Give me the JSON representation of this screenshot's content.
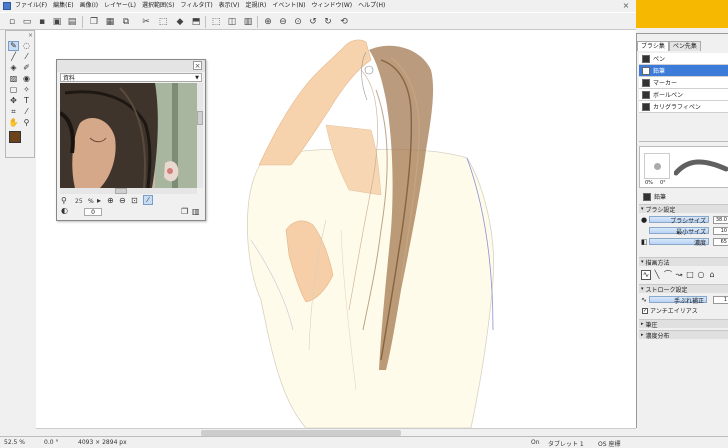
{
  "menubar": {
    "items": [
      "ファイル(F)",
      "編集(E)",
      "画像(I)",
      "レイヤー(L)",
      "選択範囲(S)",
      "フィルタ(T)",
      "表示(V)",
      "定規(R)",
      "イベント(N)",
      "ウィンドウ(W)",
      "ヘルプ(H)"
    ],
    "close_glyph": "×"
  },
  "toolbar": {
    "icons": [
      "new-file-icon",
      "open-icon",
      "save-icon",
      "save-as-icon",
      "print-icon",
      "copy-icon",
      "paste-icon",
      "cut-icon",
      "clear-icon",
      "fill-icon",
      "select-icon",
      "deselect-icon",
      "zoom-in-icon",
      "zoom-out-icon",
      "fit-icon",
      "rotate-left-icon",
      "rotate-right-icon",
      "reset-rotation-icon"
    ]
  },
  "toolbox": {
    "close_glyph": "×",
    "main_color": "#6b4219",
    "sub_color": "#ffffff"
  },
  "reference_panel": {
    "tab_label": "資料",
    "close_glyph": "×",
    "zoom_value": "25",
    "zoom_unit": "%",
    "rotation_value": "0"
  },
  "brush_panel": {
    "tabs": [
      "ブラシ集",
      "ペン先集"
    ],
    "brushes": [
      {
        "label": "ペン",
        "selected": false
      },
      {
        "label": "鉛筆",
        "selected": true
      },
      {
        "label": "マーカー",
        "selected": false
      },
      {
        "label": "ボールペン",
        "selected": false
      },
      {
        "label": "カリグラフィペン",
        "selected": false
      }
    ],
    "preview_percent": "0%",
    "preview_degree": "0°",
    "current_brush": "鉛筆",
    "section_brush_settings": "ブラシ設定",
    "brush_size_label": "ブラシサイズ",
    "brush_size_value": "38.0",
    "min_size_label": "最小サイズ",
    "min_size_value": "10",
    "density_label": "濃度",
    "density_value": "65",
    "section_drawing_method": "描画方法",
    "section_stroke_settings": "ストローク設定",
    "hand_correction_label": "手ぶれ補正",
    "hand_correction_value": "1",
    "antialias_label": "アンチエイリアス",
    "section_pressure": "筆圧",
    "section_density_distribution": "濃度分布"
  },
  "statusbar": {
    "zoom": "52.5 %",
    "rotation": "0.0 °",
    "canvas_size": "4093 × 2894 px",
    "on_label": "On",
    "tablet": "タブレット 1",
    "os_coords": "OS 座標"
  }
}
